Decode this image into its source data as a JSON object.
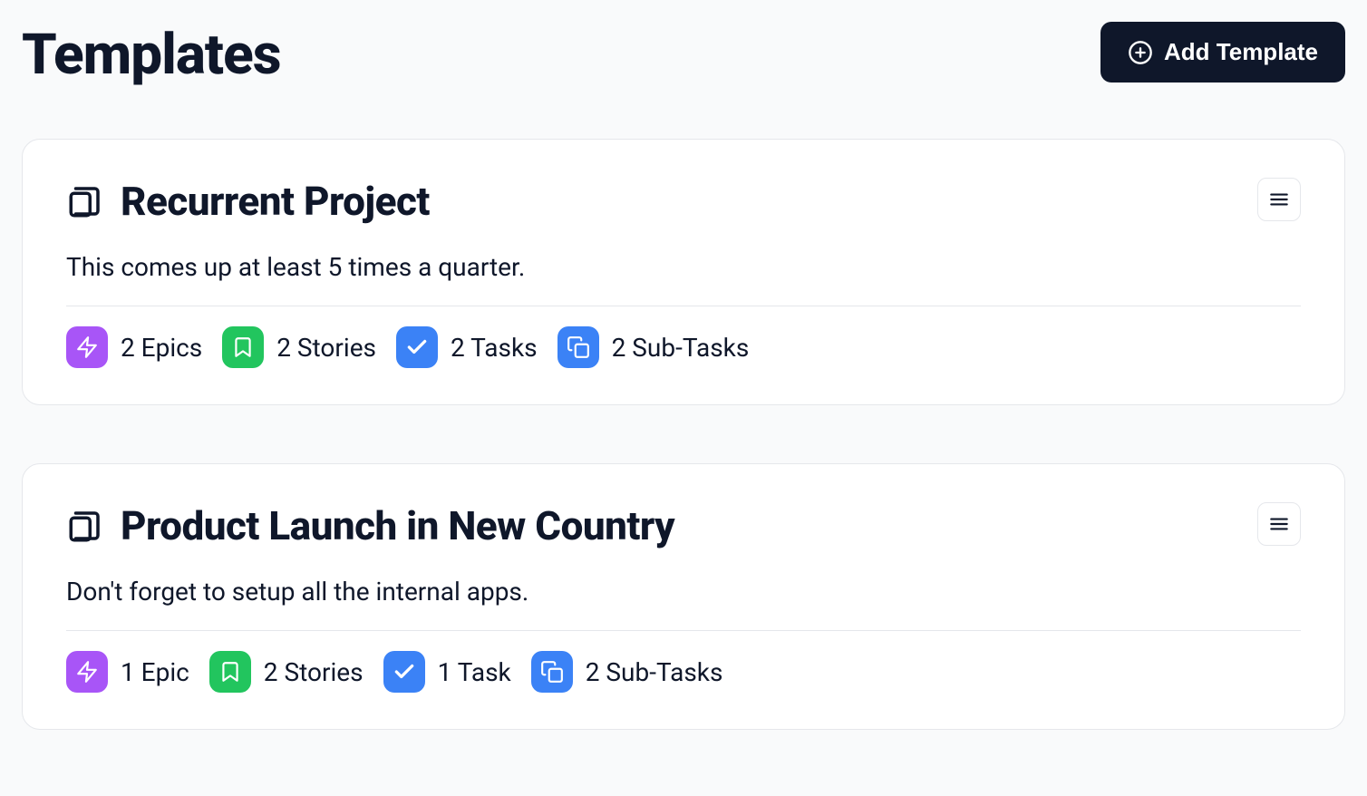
{
  "header": {
    "title": "Templates",
    "add_label": "Add Template"
  },
  "templates": [
    {
      "title": "Recurrent Project",
      "description": "This comes up at least 5 times a quarter.",
      "stats": {
        "epics": "2 Epics",
        "stories": "2 Stories",
        "tasks": "2 Tasks",
        "subtasks": "2 Sub-Tasks"
      }
    },
    {
      "title": "Product Launch in New Country",
      "description": "Don't forget to setup all the internal apps.",
      "stats": {
        "epics": "1 Epic",
        "stories": "2 Stories",
        "tasks": "1 Task",
        "subtasks": "2 Sub-Tasks"
      }
    }
  ]
}
